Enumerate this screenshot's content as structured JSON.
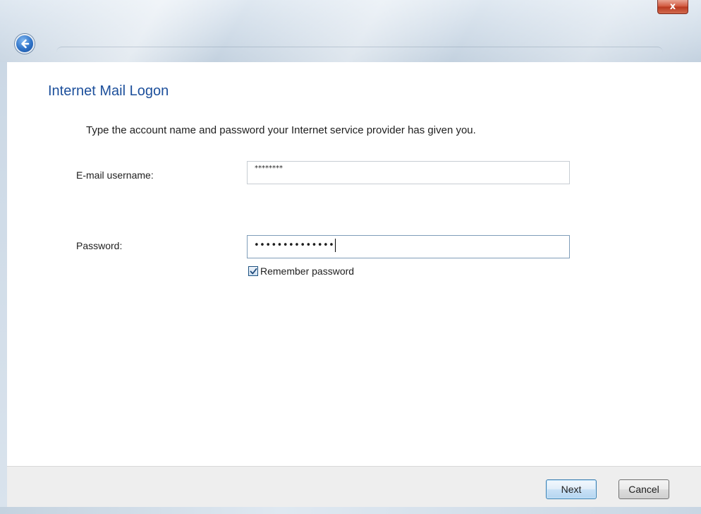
{
  "window": {
    "close_label": "x"
  },
  "header": {
    "title": "Internet Mail Logon",
    "instructions": "Type the account name and password your Internet service provider has given you."
  },
  "form": {
    "username_label": "E-mail username:",
    "username_value": "********",
    "password_label": "Password:",
    "password_display": "••••••••••••••",
    "remember_label": "Remember password",
    "remember_checked": true
  },
  "footer": {
    "next_label": "Next",
    "cancel_label": "Cancel"
  },
  "colors": {
    "title_blue": "#1c4f9b",
    "footer_bg": "#eeeeee",
    "close_red": "#c8452a"
  },
  "icons": {
    "back": "back-arrow-icon",
    "close": "close-icon",
    "check": "checkmark-icon"
  }
}
